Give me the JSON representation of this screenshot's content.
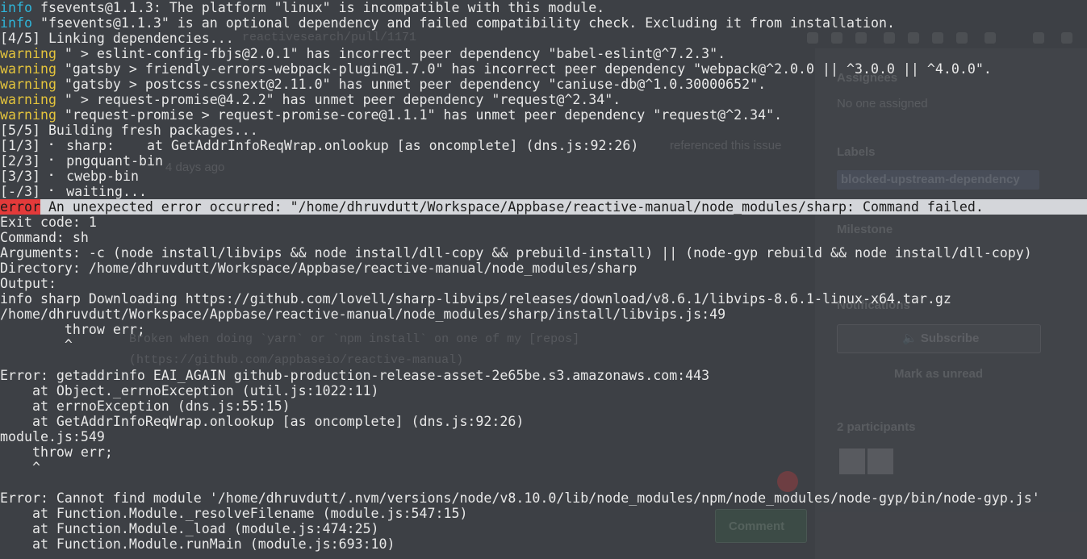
{
  "terminal": {
    "lines": [
      {
        "tag": "info",
        "text": " fsevents@1.1.3: The platform \"linux\" is incompatible with this module."
      },
      {
        "tag": "info",
        "text": " \"fsevents@1.1.3\" is an optional dependency and failed compatibility check. Excluding it from installation."
      },
      {
        "tag": "",
        "text": "[4/5] Linking dependencies..."
      },
      {
        "tag": "warning",
        "text": " \" > eslint-config-fbjs@2.0.1\" has incorrect peer dependency \"babel-eslint@^7.2.3\"."
      },
      {
        "tag": "warning",
        "text": " \"gatsby > friendly-errors-webpack-plugin@1.7.0\" has incorrect peer dependency \"webpack@^2.0.0 || ^3.0.0 || ^4.0.0\"."
      },
      {
        "tag": "warning",
        "text": " \"gatsby > postcss-cssnext@2.11.0\" has unmet peer dependency \"caniuse-db@^1.0.30000652\"."
      },
      {
        "tag": "warning",
        "text": " \" > request-promise@4.2.2\" has unmet peer dependency \"request@^2.34\"."
      },
      {
        "tag": "warning",
        "text": " \"request-promise > request-promise-core@1.1.1\" has unmet peer dependency \"request@^2.34\"."
      },
      {
        "tag": "",
        "text": "[5/5] Building fresh packages..."
      },
      {
        "tag": "",
        "text": "[1/3] ⠂ sharp:    at GetAddrInfoReqWrap.onlookup [as oncomplete] (dns.js:92:26)"
      },
      {
        "tag": "",
        "text": "[2/3] ⠂ pngquant-bin"
      },
      {
        "tag": "",
        "text": "[3/3] ⠂ cwebp-bin"
      },
      {
        "tag": "",
        "text": "[-/3] ⠂ waiting..."
      },
      {
        "tag": "error",
        "text": " An unexpected error occurred: \"/home/dhruvdutt/Workspace/Appbase/reactive-manual/node_modules/sharp: Command failed."
      },
      {
        "tag": "",
        "text": "Exit code: 1"
      },
      {
        "tag": "",
        "text": "Command: sh"
      },
      {
        "tag": "",
        "text": "Arguments: -c (node install/libvips && node install/dll-copy && prebuild-install) || (node-gyp rebuild && node install/dll-copy)"
      },
      {
        "tag": "",
        "text": "Directory: /home/dhruvdutt/Workspace/Appbase/reactive-manual/node_modules/sharp"
      },
      {
        "tag": "",
        "text": "Output:"
      },
      {
        "tag": "",
        "text": "info sharp Downloading https://github.com/lovell/sharp-libvips/releases/download/v8.6.1/libvips-8.6.1-linux-x64.tar.gz"
      },
      {
        "tag": "",
        "text": "/home/dhruvdutt/Workspace/Appbase/reactive-manual/node_modules/sharp/install/libvips.js:49"
      },
      {
        "tag": "",
        "text": "        throw err;"
      },
      {
        "tag": "",
        "text": "        ^"
      },
      {
        "tag": "",
        "text": ""
      },
      {
        "tag": "",
        "text": "Error: getaddrinfo EAI_AGAIN github-production-release-asset-2e65be.s3.amazonaws.com:443"
      },
      {
        "tag": "",
        "text": "    at Object._errnoException (util.js:1022:11)"
      },
      {
        "tag": "",
        "text": "    at errnoException (dns.js:55:15)"
      },
      {
        "tag": "",
        "text": "    at GetAddrInfoReqWrap.onlookup [as oncomplete] (dns.js:92:26)"
      },
      {
        "tag": "",
        "text": "module.js:549"
      },
      {
        "tag": "",
        "text": "    throw err;"
      },
      {
        "tag": "",
        "text": "    ^"
      },
      {
        "tag": "",
        "text": ""
      },
      {
        "tag": "",
        "text": "Error: Cannot find module '/home/dhruvdutt/.nvm/versions/node/v8.10.0/lib/node_modules/npm/node_modules/node-gyp/bin/node-gyp.js'"
      },
      {
        "tag": "",
        "text": "    at Function.Module._resolveFilename (module.js:547:15)"
      },
      {
        "tag": "",
        "text": "    at Function.Module._load (module.js:474:25)"
      },
      {
        "tag": "",
        "text": "    at Function.Module.runMain (module.js:693:10)"
      }
    ]
  },
  "background": {
    "url_fragment": "reactivesearch/pull/1171",
    "assignees_heading": "Assignees",
    "assignees_value": "No one assigned",
    "labels_heading": "Labels",
    "label_chip": "blocked-upstream-dependency",
    "milestone_heading": "Milestone",
    "notifications_heading": "Notifications",
    "subscribe_label": "Subscribe",
    "mark_unread_label": "Mark as unread",
    "participants_label": "2 participants",
    "referenced_text": "referenced this issue",
    "days_ago_text": "4 days ago",
    "body_line_1": "Broken when doing `yarn` or `npm install` on one of my [repos]",
    "body_line_2": "(https://github.com/appbaseio/reactive-manual)",
    "comment_button": "Comment"
  },
  "colors": {
    "info": "#2fb5d9",
    "warning": "#e3c33c",
    "error_tag_bg": "#e33a3a",
    "error_line_bg": "#d4d6da",
    "terminal_bg": "#3d4045",
    "text": "#e8e8e8"
  }
}
